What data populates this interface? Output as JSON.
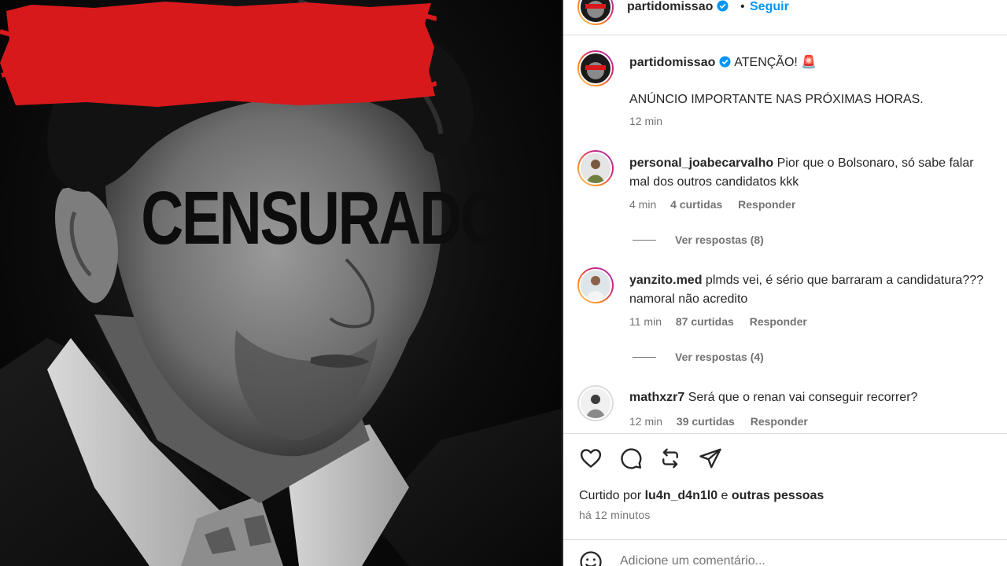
{
  "image": {
    "overlay_text": "CENSURADO",
    "overlay_color": "#d7191c"
  },
  "header": {
    "username": "partidomissao",
    "separator": "•",
    "follow_label": "Seguir"
  },
  "caption": {
    "username": "partidomissao",
    "text": "ATENÇÃO! 🚨",
    "body": "ANÚNCIO IMPORTANTE NAS PRÓXIMAS HORAS.",
    "time": "12 min"
  },
  "comments": [
    {
      "username": "personal_joabecarvalho",
      "text_line1": "Pior que o Bolsonaro, só sabe falar",
      "text_line2": "mal dos outros candidatos kkk",
      "time": "4 min",
      "likes": "4 curtidas",
      "reply": "Responder",
      "view_replies": "Ver respostas (8)"
    },
    {
      "username": "yanzito.med",
      "text_line1": "plmds vei, é sério que barraram a candidatura???",
      "text_line2": "namoral não acredito",
      "time": "11 min",
      "likes": "87 curtidas",
      "reply": "Responder",
      "view_replies": "Ver respostas (4)"
    },
    {
      "username": "mathxzr7",
      "text_line1": "Será que o renan vai conseguir recorrer?",
      "time": "12 min",
      "likes": "39 curtidas",
      "reply": "Responder"
    }
  ],
  "footer": {
    "liked_prefix": "Curtido por",
    "liked_user": "lu4n_d4n1l0",
    "liked_mid": "e",
    "liked_others": "outras pessoas",
    "time_ago": "há 12 minutos",
    "add_comment_placeholder": "Adicione um comentário..."
  },
  "colors": {
    "link_blue": "#0095f6",
    "verified_blue": "#0095f6",
    "muted": "#737373"
  }
}
